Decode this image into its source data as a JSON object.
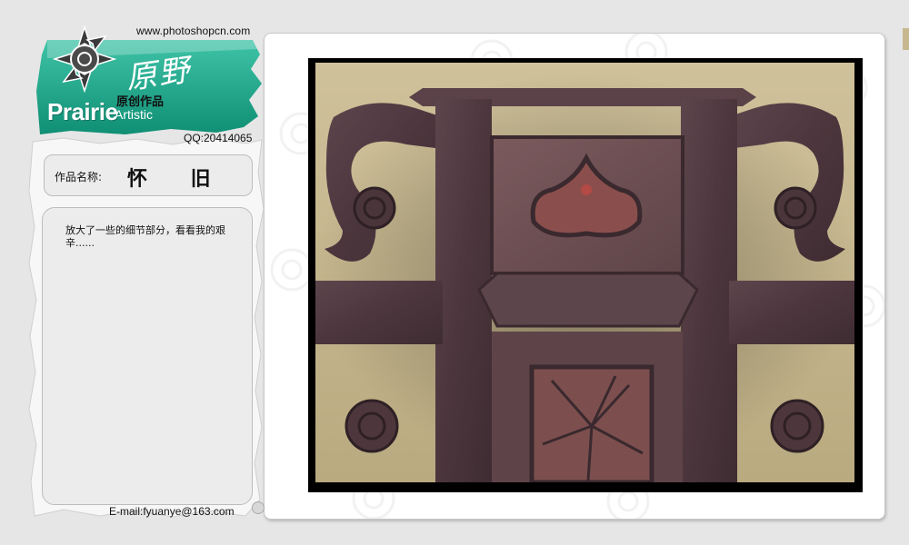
{
  "header": {
    "site_url": "www.photoshopcn.com",
    "logo_word": "Prairie",
    "logo_artistic": "Artistic",
    "logo_cn_title": "原创作品",
    "logo_brush_text": "原野",
    "qq": "QQ:20414065"
  },
  "work": {
    "name_label": "作品名称:",
    "name_value": "怀 旧",
    "description": "放大了一些的细节部分，看看我的艰辛......"
  },
  "footer": {
    "email": "E-mail:fyuanye@163.com"
  },
  "colors": {
    "page_bg": "#e6e6e6",
    "logo_teal": "#1aa58a",
    "panel_bg": "#ffffff",
    "box_bg": "#ececec",
    "wood_dark": "#4e3a41",
    "wood_mid": "#6a4f55",
    "wall_tan": "#c4b68d"
  },
  "icons": {
    "logo_emblem": "sun-emblem-icon",
    "corner_dot": "circle-icon"
  }
}
